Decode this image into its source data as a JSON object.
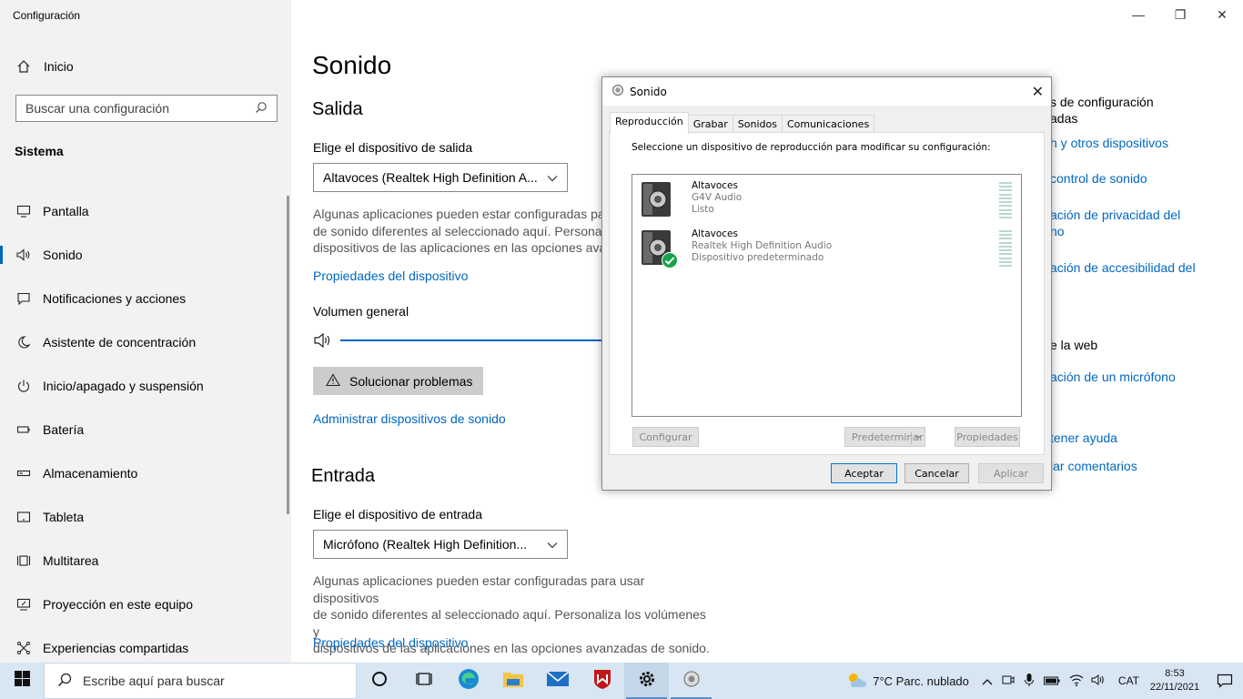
{
  "app": {
    "title": "Configuración"
  },
  "sidebar": {
    "home": "Inicio",
    "search_placeholder": "Buscar una configuración",
    "section": "Sistema",
    "items": [
      {
        "label": "Pantalla",
        "icon": "monitor-icon"
      },
      {
        "label": "Sonido",
        "icon": "speaker-icon",
        "active": true
      },
      {
        "label": "Notificaciones y acciones",
        "icon": "notification-icon"
      },
      {
        "label": "Asistente de concentración",
        "icon": "moon-icon"
      },
      {
        "label": "Inicio/apagado y suspensión",
        "icon": "power-icon"
      },
      {
        "label": "Batería",
        "icon": "battery-icon"
      },
      {
        "label": "Almacenamiento",
        "icon": "storage-icon"
      },
      {
        "label": "Tableta",
        "icon": "tablet-icon"
      },
      {
        "label": "Multitarea",
        "icon": "multitask-icon"
      },
      {
        "label": "Proyección en este equipo",
        "icon": "projection-icon"
      },
      {
        "label": "Experiencias compartidas",
        "icon": "shared-icon"
      }
    ]
  },
  "main": {
    "title": "Sonido",
    "output": {
      "heading": "Salida",
      "choose_label": "Elige el dispositivo de salida",
      "device": "Altavoces (Realtek High Definition A...",
      "desc_lines": [
        "Algunas aplicaciones pueden estar configuradas pa",
        "de sonido diferentes al seleccionado aquí. Personali",
        "dispositivos de las aplicaciones en las opciones avar"
      ],
      "properties_link": "Propiedades del dispositivo",
      "volume_label": "Volumen general",
      "troubleshoot": "Solucionar problemas",
      "manage_link": "Administrar dispositivos de sonido"
    },
    "input": {
      "heading": "Entrada",
      "choose_label": "Elige el dispositivo de entrada",
      "device": "Micrófono (Realtek High Definition...",
      "desc_lines": [
        "Algunas aplicaciones pueden estar configuradas para usar dispositivos",
        "de sonido diferentes al seleccionado aquí. Personaliza los volúmenes y",
        "dispositivos de las aplicaciones en las opciones avanzadas de sonido."
      ],
      "properties_link": "Propiedades del dispositivo"
    },
    "related": {
      "line1": "s de configuración",
      "line2": "adas",
      "links": [
        "h y otros dispositivos",
        "control de sonido",
        "ación de privacidad del",
        "no",
        "ación de accesibilidad del"
      ],
      "web_label": "e la web",
      "web_link": "ación de un micrófono",
      "help": "tener ayuda",
      "feedback": "iar comentarios"
    }
  },
  "dialog": {
    "title": "Sonido",
    "tabs": [
      "Reproducción",
      "Grabar",
      "Sonidos",
      "Comunicaciones"
    ],
    "instruction": "Seleccione un dispositivo de reproducción para modificar su configuración:",
    "devices": [
      {
        "name": "Altavoces",
        "detail": "G4V Audio",
        "status": "Listo",
        "default": false
      },
      {
        "name": "Altavoces",
        "detail": "Realtek High Definition Audio",
        "status": "Dispositivo predeterminado",
        "default": true
      }
    ],
    "buttons": {
      "configure": "Configurar",
      "set_default": "Predeterminar",
      "properties": "Propiedades",
      "ok": "Aceptar",
      "cancel": "Cancelar",
      "apply": "Aplicar"
    }
  },
  "taskbar": {
    "search_placeholder": "Escribe aquí para buscar",
    "weather": "7°C  Parc. nublado",
    "language": "CAT",
    "time": "8:53",
    "date": "22/11/2021"
  },
  "colors": {
    "accent": "#0067c0",
    "taskbar": "#d8e6f3",
    "sidebar": "#f2f2f2"
  }
}
